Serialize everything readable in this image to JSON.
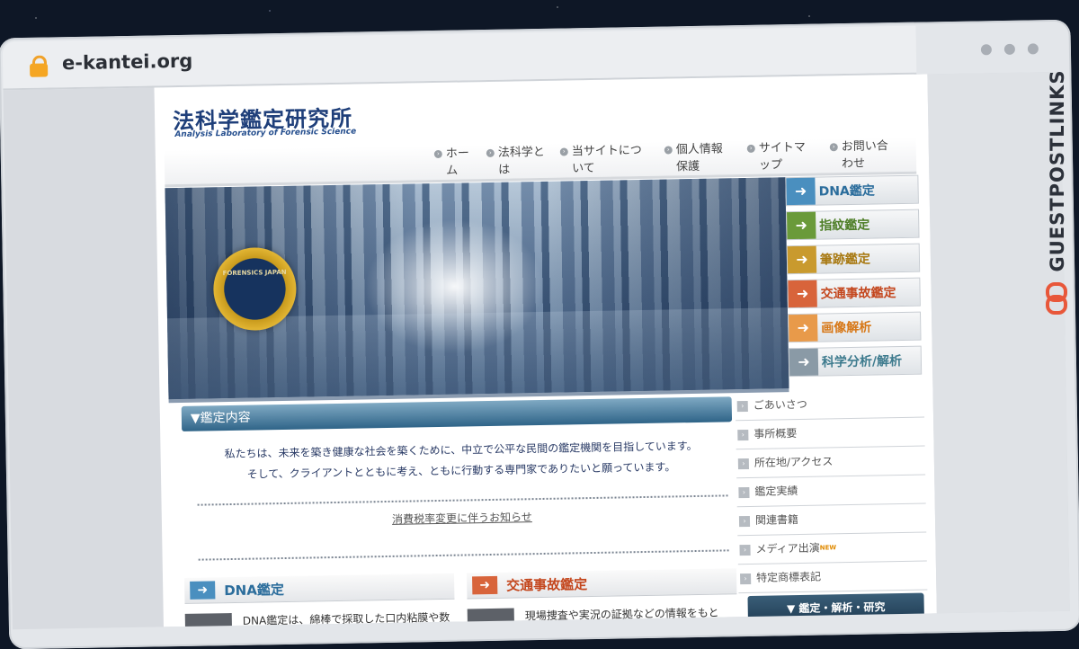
{
  "browser": {
    "url": "e-kantei.org"
  },
  "site": {
    "logo_jp": "法科学鑑定研究所",
    "logo_en": "Analysis Laboratory of Forensic Science",
    "seal_text": "FORENSICS JAPAN"
  },
  "nav": [
    {
      "line1": "ホー",
      "line2": "ム"
    },
    {
      "line1": "法科学と",
      "line2": "は"
    },
    {
      "line1": "当サイトにつ",
      "line2": "いて"
    },
    {
      "line1": "個人情報",
      "line2": "保護"
    },
    {
      "line1": "サイトマ",
      "line2": "ップ"
    },
    {
      "line1": "お問い合",
      "line2": "わせ"
    }
  ],
  "services": [
    {
      "label": "DNA鑑定",
      "color": "#4a8fbf",
      "text_color": "#2b6d9c"
    },
    {
      "label": "指紋鑑定",
      "color": "#6a9a3a",
      "text_color": "#4f7f28"
    },
    {
      "label": "筆跡鑑定",
      "color": "#c99a2e",
      "text_color": "#a87912"
    },
    {
      "label": "交通事故鑑定",
      "color": "#d8643b",
      "text_color": "#c4471e"
    },
    {
      "label": "画像解析",
      "color": "#e89a4a",
      "text_color": "#d77818"
    },
    {
      "label": "科学分析/解析",
      "color": "#8a9aa6",
      "text_color": "#3e7b8e"
    }
  ],
  "main": {
    "section_title": "▼鑑定内容",
    "intro_line1": "私たちは、未来を築き健康な社会を築くために、中立で公平な民間の鑑定機関を目指しています。",
    "intro_line2": "そして、クライアントとともに考え、ともに行動する専門家でありたいと願っています。",
    "notice": "消費税率変更に伴うお知らせ"
  },
  "cards": [
    {
      "title": "DNA鑑定",
      "color": "#4a8fbf",
      "title_color": "#2b6d9c",
      "text": "DNA鑑定は、綿棒で採取した口内粘膜や数"
    },
    {
      "title": "交通事故鑑定",
      "color": "#d8643b",
      "title_color": "#c4471e",
      "text": "現場捜査や実況の証拠などの情報をもと"
    }
  ],
  "right_menu": {
    "items": [
      "ごあいさつ",
      "事所概要",
      "所在地/アクセス",
      "鑑定実績",
      "関連書籍",
      "メディア出演",
      "特定商標表記"
    ],
    "new_badge": "NEW",
    "button": "▼ 鑑定・解析・研究"
  },
  "brand": {
    "text": "GUESTPOSTLINKS"
  }
}
